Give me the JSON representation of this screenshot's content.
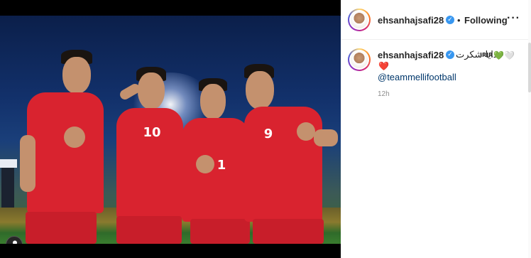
{
  "post": {
    "author": {
      "username": "ehsanhajsafi28",
      "verified": true,
      "avatar_icon": "profile-avatar"
    },
    "follow_status": "Following",
    "separator": "•",
    "more_label": "···",
    "caption": {
      "username": "ehsanhajsafi28",
      "text": "خدایا شکرت",
      "tag": "IRIR",
      "emojis": [
        "💚",
        "🤍",
        "❤️"
      ],
      "mention": "@teammellifootball"
    },
    "timestamp": "12h"
  },
  "photo": {
    "players": [
      {
        "number": "",
        "name": "player-left"
      },
      {
        "number": "10",
        "name": "player-saluting"
      },
      {
        "number": "1",
        "name": "player-center"
      },
      {
        "number": "9",
        "name": "player-right"
      }
    ],
    "jersey_color": "#d9232f"
  },
  "colors": {
    "verified_blue": "#3897f0",
    "mention_blue": "#00376b",
    "text_dark": "#262626",
    "muted": "#8e8e8e",
    "heart_green": "#2fbf3b",
    "heart_red": "#ed1c24"
  }
}
